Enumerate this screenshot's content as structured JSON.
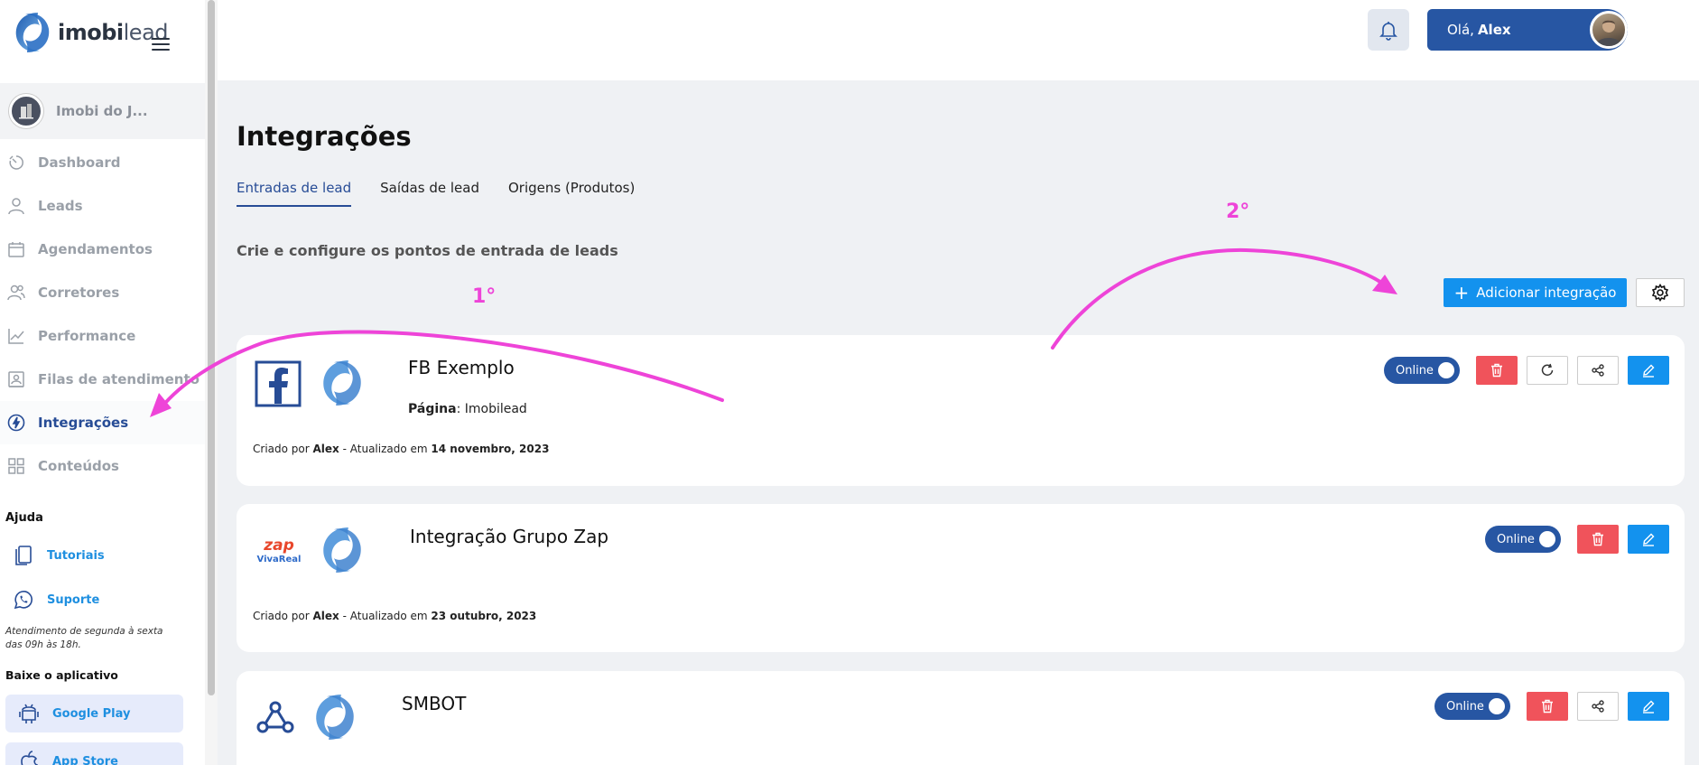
{
  "sidebar": {
    "logo": {
      "bold": "imobi",
      "light": "lead"
    },
    "company_name": "Imobi do J...",
    "nav": [
      {
        "label": "Dashboard",
        "icon": "dashboard-icon"
      },
      {
        "label": "Leads",
        "icon": "user-icon"
      },
      {
        "label": "Agendamentos",
        "icon": "calendar-icon"
      },
      {
        "label": "Corretores",
        "icon": "users-icon"
      },
      {
        "label": "Performance",
        "icon": "chart-line-icon"
      },
      {
        "label": "Filas de atendimento",
        "icon": "queue-icon"
      },
      {
        "label": "Integrações",
        "icon": "bolt-icon",
        "active": true
      },
      {
        "label": "Conteúdos",
        "icon": "grid-icon"
      }
    ],
    "help": {
      "title": "Ajuda",
      "tutorials": "Tutoriais",
      "support": "Suporte",
      "note": "Atendimento de segunda à sexta das 09h às 18h."
    },
    "app": {
      "title": "Baixe o aplicativo",
      "google_play": "Google Play",
      "app_store": "App Store"
    }
  },
  "header": {
    "greeting": "Olá,",
    "user_name": "Alex"
  },
  "main": {
    "title": "Integrações",
    "tabs": [
      {
        "label": "Entradas de lead",
        "active": true
      },
      {
        "label": "Saídas de lead"
      },
      {
        "label": "Origens (Produtos)"
      }
    ],
    "subtitle": "Crie e configure os pontos de entrada de leads",
    "add_button": "Adicionar integração",
    "cards": [
      {
        "title": "FB Exemplo",
        "field_label": "Página",
        "field_value": ": Imobilead",
        "meta_prefix": "Criado por",
        "meta_author": "Alex",
        "meta_mid": "- Atualizado em",
        "meta_date": "14 novembro, 2023",
        "status": "Online"
      },
      {
        "title": "Integração Grupo Zap",
        "zap_logo_top": "zap",
        "zap_logo_bottom": "VivaReal",
        "meta_prefix": "Criado por",
        "meta_author": "Alex",
        "meta_mid": "- Atualizado em",
        "meta_date": "23 outubro, 2023",
        "status": "Online"
      },
      {
        "title": "SMBOT",
        "status": "Online"
      }
    ]
  },
  "annotations": {
    "first": "1°",
    "second": "2°"
  },
  "colors": {
    "primary": "#2756a3",
    "accent_blue": "#1392ee",
    "danger": "#f0535b",
    "annotation": "#ee44d8"
  }
}
